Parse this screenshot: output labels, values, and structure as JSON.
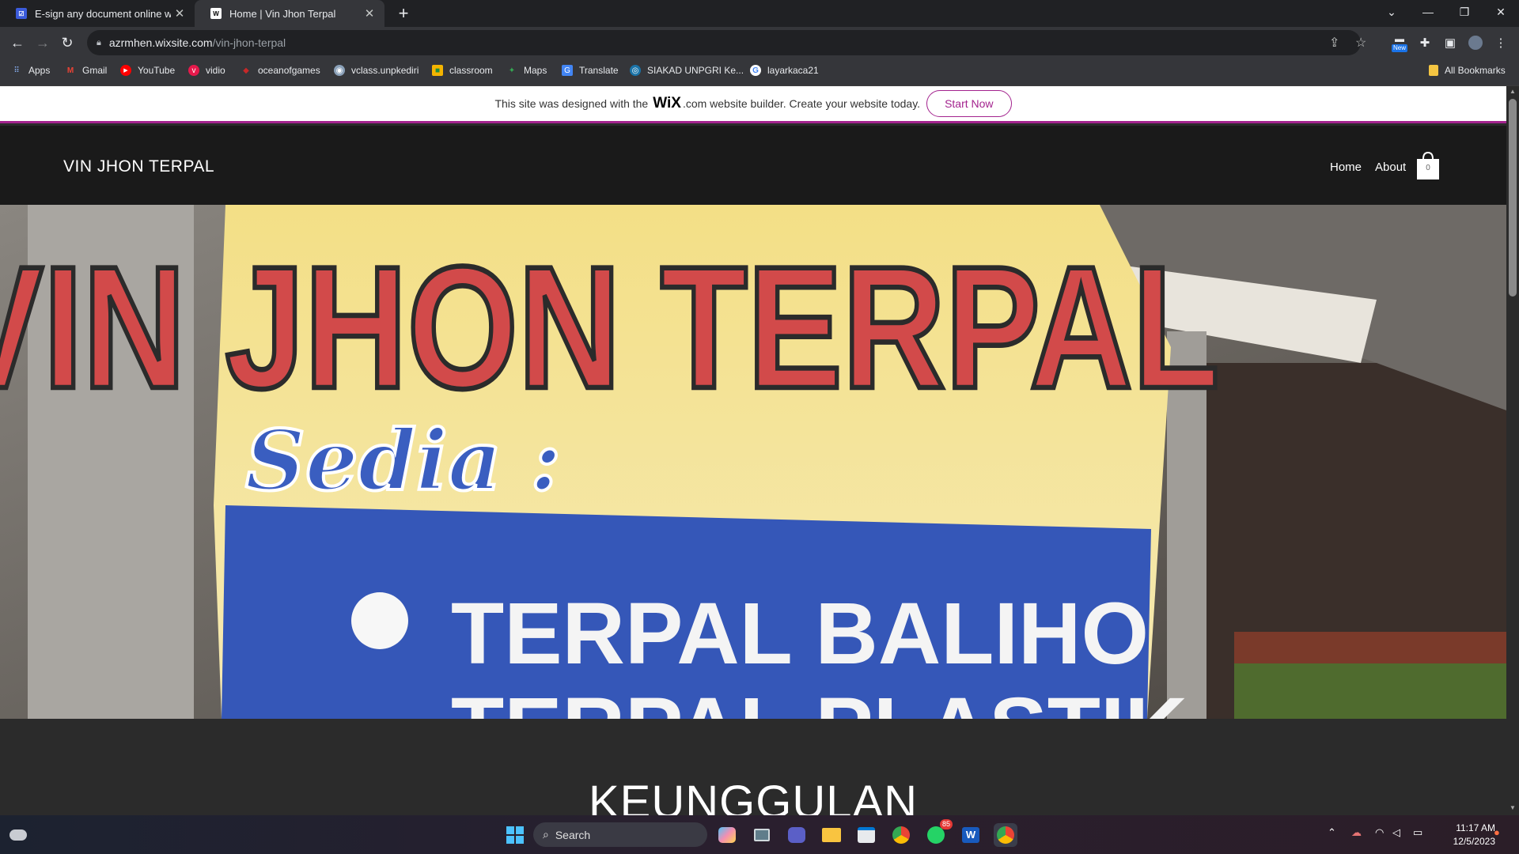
{
  "browser": {
    "tabs": [
      {
        "title": "E-sign any document online wit",
        "favicon": "docs-icon",
        "active": false
      },
      {
        "title": "Home | Vin Jhon Terpal",
        "favicon": "wix-icon",
        "active": true
      }
    ],
    "new_tab": "+",
    "window": {
      "minimize": "—",
      "maximize": "❐",
      "close": "✕",
      "tab_search": "⌄"
    },
    "address": {
      "host": "azrmhen.wixsite.com",
      "path": "/vin-jhon-terpal"
    },
    "toolbar_icons": [
      "share-icon",
      "star-icon",
      "extension-new-icon",
      "puzzle-icon",
      "sidepanel-icon",
      "profile-icon",
      "menu-icon"
    ],
    "new_badge": "New",
    "bookmarks": [
      {
        "label": "Apps",
        "icon": "apps-icon"
      },
      {
        "label": "Gmail",
        "icon": "gmail-icon"
      },
      {
        "label": "YouTube",
        "icon": "youtube-icon"
      },
      {
        "label": "vidio",
        "icon": "vidio-icon"
      },
      {
        "label": "oceanofgames",
        "icon": "game-icon"
      },
      {
        "label": "vclass.unpkediri",
        "icon": "vclass-icon"
      },
      {
        "label": "classroom",
        "icon": "classroom-icon"
      },
      {
        "label": "Maps",
        "icon": "maps-icon"
      },
      {
        "label": "Translate",
        "icon": "translate-icon"
      },
      {
        "label": "SIAKAD UNPGRI Ke...",
        "icon": "siakad-icon"
      },
      {
        "label": "layarkaca21",
        "icon": "google-icon"
      }
    ],
    "all_bookmarks": "All Bookmarks"
  },
  "wix_banner": {
    "text_before": "This site was designed with the",
    "logo": "WiX",
    "text_after": ".com website builder. Create your website today.",
    "cta": "Start Now",
    "accent": "#a3238e"
  },
  "site": {
    "title": "VIN JHON TERPAL",
    "nav": [
      "Home",
      "About"
    ],
    "cart_count": "0",
    "hero": {
      "line1": "VIN JHON TERPAL",
      "line2": "Sedia :",
      "bullet1": "TERPAL BALIHO",
      "bullet2": "TERPAL PLASTIK"
    },
    "section_title": "KEUNGGULAN"
  },
  "taskbar": {
    "search_placeholder": "Search",
    "whatsapp_badge": "85",
    "time": "11:17 AM",
    "date": "12/5/2023"
  }
}
